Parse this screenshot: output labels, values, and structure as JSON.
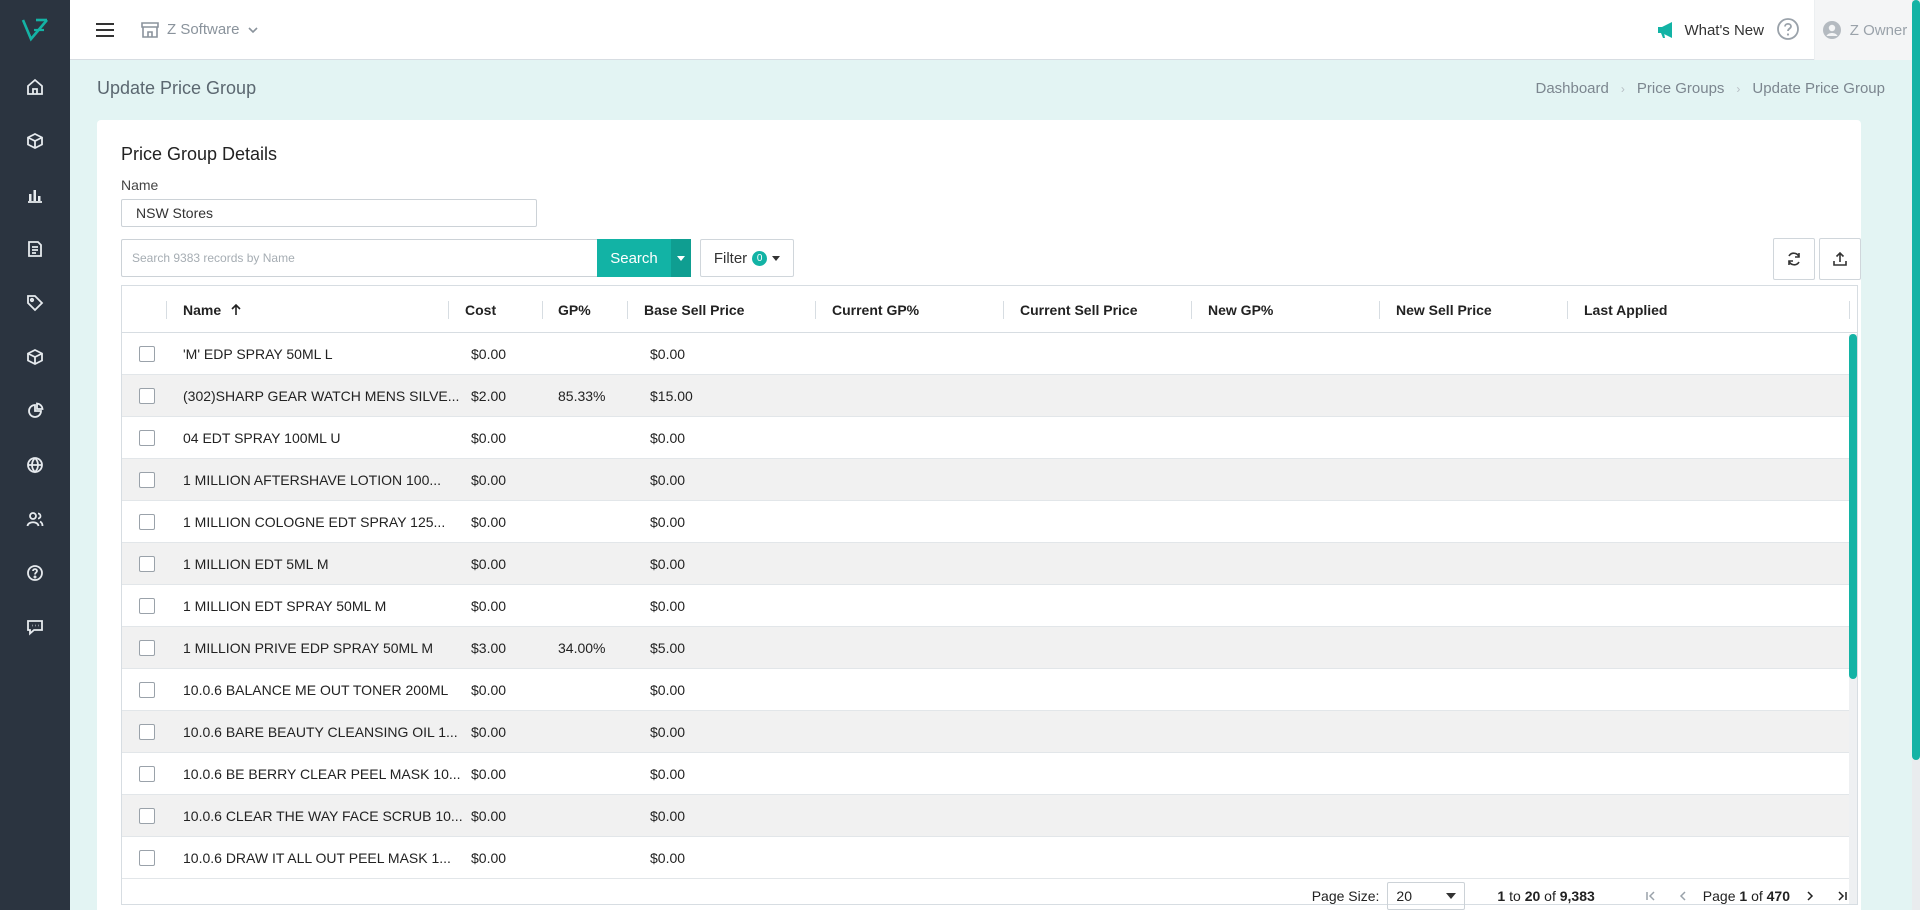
{
  "topbar": {
    "company": "Z Software",
    "whats_new": "What's New",
    "user": "Z Owner"
  },
  "page": {
    "title": "Update Price Group",
    "breadcrumb": [
      "Dashboard",
      "Price Groups",
      "Update Price Group"
    ]
  },
  "card": {
    "title": "Price Group Details",
    "name_label": "Name",
    "name_value": "NSW Stores",
    "search_placeholder": "Search 9383 records by Name",
    "search_label": "Search",
    "filter_label": "Filter",
    "filter_count": "0"
  },
  "grid": {
    "columns": [
      "Name",
      "Cost",
      "GP%",
      "Base Sell Price",
      "Current GP%",
      "Current Sell Price",
      "New GP%",
      "New Sell Price",
      "Last Applied"
    ],
    "rows": [
      {
        "name": "'M' EDP SPRAY 50ML L",
        "cost": "$0.00",
        "gp": "",
        "base": "$0.00"
      },
      {
        "name": "(302)SHARP GEAR WATCH MENS SILVE...",
        "cost": "$2.00",
        "gp": "85.33%",
        "base": "$15.00"
      },
      {
        "name": "04 EDT SPRAY 100ML U",
        "cost": "$0.00",
        "gp": "",
        "base": "$0.00"
      },
      {
        "name": "1 MILLION AFTERSHAVE LOTION 100...",
        "cost": "$0.00",
        "gp": "",
        "base": "$0.00"
      },
      {
        "name": "1 MILLION COLOGNE EDT SPRAY 125...",
        "cost": "$0.00",
        "gp": "",
        "base": "$0.00"
      },
      {
        "name": "1 MILLION EDT 5ML M",
        "cost": "$0.00",
        "gp": "",
        "base": "$0.00"
      },
      {
        "name": "1 MILLION EDT SPRAY 50ML M",
        "cost": "$0.00",
        "gp": "",
        "base": "$0.00"
      },
      {
        "name": "1 MILLION PRIVE EDP SPRAY 50ML M",
        "cost": "$3.00",
        "gp": "34.00%",
        "base": "$5.00"
      },
      {
        "name": "10.0.6 BALANCE ME OUT TONER 200ML",
        "cost": "$0.00",
        "gp": "",
        "base": "$0.00"
      },
      {
        "name": "10.0.6 BARE BEAUTY CLEANSING OIL 1...",
        "cost": "$0.00",
        "gp": "",
        "base": "$0.00"
      },
      {
        "name": "10.0.6 BE BERRY CLEAR PEEL MASK 10...",
        "cost": "$0.00",
        "gp": "",
        "base": "$0.00"
      },
      {
        "name": "10.0.6 CLEAR THE WAY FACE SCRUB 10...",
        "cost": "$0.00",
        "gp": "",
        "base": "$0.00"
      },
      {
        "name": "10.0.6 DRAW IT ALL OUT PEEL MASK 1...",
        "cost": "$0.00",
        "gp": "",
        "base": "$0.00"
      }
    ]
  },
  "pager": {
    "page_size_label": "Page Size:",
    "page_size": "20",
    "range_from": "1",
    "range_to_word": "to",
    "range_to": "20",
    "range_of_word": "of",
    "total": "9,383",
    "page_word": "Page",
    "page": "1",
    "of_word": "of",
    "pages": "470"
  },
  "colors": {
    "accent": "#12b3a5",
    "sidebar": "#2b3440",
    "page_bg": "#e3f4f3"
  }
}
